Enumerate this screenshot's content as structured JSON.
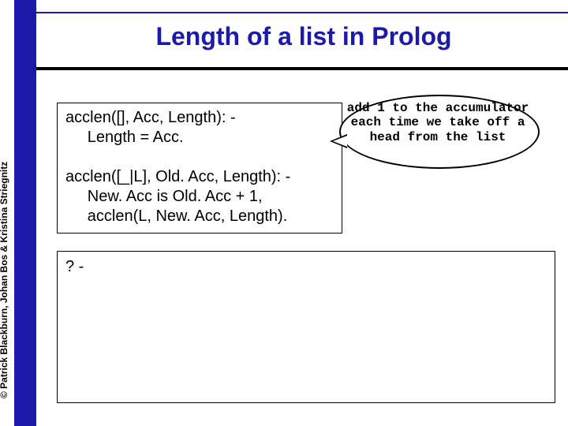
{
  "title": "Length of a list in Prolog",
  "credit": "© Patrick Blackburn, Johan Bos & Kristina Striegnitz",
  "code": "acclen([], Acc, Length): -\n     Length = Acc.\n\nacclen([_|L], Old. Acc, Length): -\n     New. Acc is Old. Acc + 1,\n     acclen(L, New. Acc, Length).",
  "callout": "add 1 to the\naccumulator each time\nwe take off a head\nfrom the list",
  "query": "? -"
}
